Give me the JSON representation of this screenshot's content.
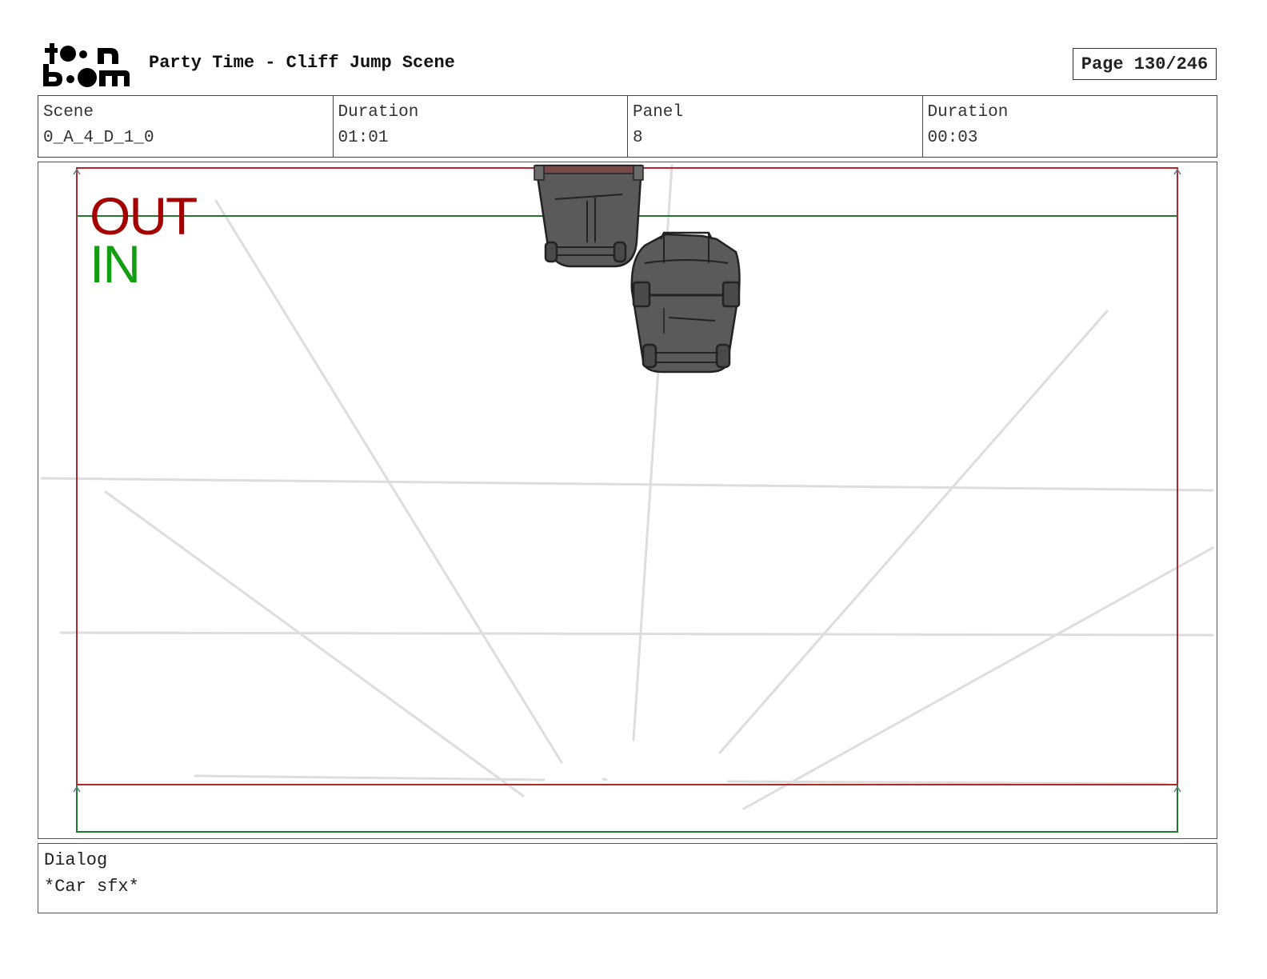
{
  "header": {
    "logo": {
      "line1": "toon",
      "line2": "boom"
    },
    "title": "Party Time - Cliff Jump Scene",
    "page": "Page 130/246"
  },
  "info": {
    "scene": {
      "label": "Scene",
      "value": "0_A_4_D_1_0"
    },
    "scene_duration": {
      "label": "Duration",
      "value": "01:01"
    },
    "panel": {
      "label": "Panel",
      "value": "8"
    },
    "panel_duration": {
      "label": "Duration",
      "value": "00:03"
    }
  },
  "panel_frame": {
    "out_label": "OUT",
    "in_label": "IN",
    "colors": {
      "out": "#a50000",
      "in": "#129d12",
      "guide": "#dddddd",
      "car": "#5a5a5a"
    }
  },
  "dialog": {
    "label": "Dialog",
    "text": "*Car sfx*"
  }
}
